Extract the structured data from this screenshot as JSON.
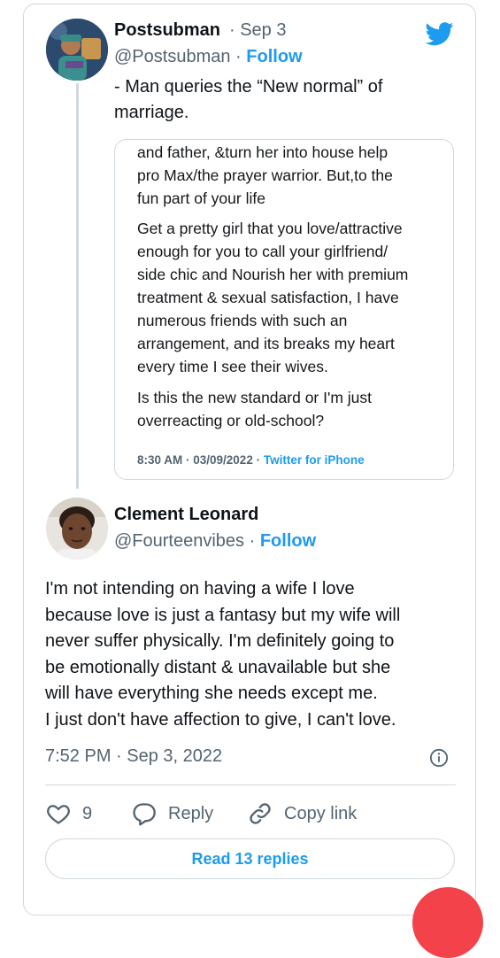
{
  "colors": {
    "accent": "#1d9bf0",
    "text": "#0f1419",
    "muted": "#536471",
    "border": "#cfd9de",
    "fab": "#f4424a"
  },
  "tweet1": {
    "display_name": "Postsubman",
    "date": "Sep 3",
    "handle": "@Postsubman",
    "follow_label": "Follow",
    "text": "- Man queries the “New normal” of marriage."
  },
  "quote": {
    "top_lines": [
      "and father, &turn her into house help",
      "pro Max/the prayer warrior. But,to the",
      "fun part of your life"
    ],
    "para2_lines": [
      "Get a pretty girl that you love/attractive",
      "enough for you to call your girlfriend/",
      "side chic and Nourish her with premium",
      "treatment & sexual satisfaction, I have",
      "numerous friends with such an",
      "arrangement, and its breaks my heart",
      "every time I see their wives."
    ],
    "para3_lines": [
      "Is this the new standard or I'm just",
      "overreacting or old-school?"
    ],
    "timestamp": "8:30 AM · 03/09/2022 ·",
    "source": "Twitter for iPhone"
  },
  "tweet2": {
    "display_name": "Clement Leonard",
    "handle": "@Fourteenvibes",
    "follow_label": "Follow",
    "lines": [
      "I'm not intending on having a wife I love",
      "because love is just a fantasy but my wife will",
      "never suffer physically. I'm definitely going to",
      "be emotionally distant & unavailable but she",
      "will have everything she needs except me.",
      "I just don't have affection to give, I can't love."
    ],
    "time": "7:52 PM · Sep 3, 2022"
  },
  "actions": {
    "like_count": "9",
    "reply_label": "Reply",
    "copy_link_label": "Copy link"
  },
  "read_replies_label": "Read 13 replies",
  "icons": [
    "twitter-bird-icon",
    "info-icon",
    "heart-icon",
    "reply-icon",
    "link-icon"
  ]
}
